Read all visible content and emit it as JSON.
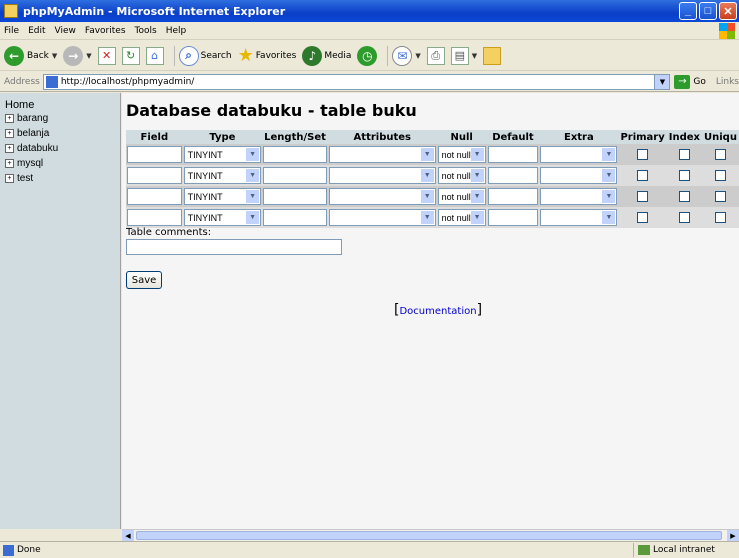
{
  "window": {
    "title": "phpMyAdmin - Microsoft Internet Explorer"
  },
  "menu": [
    "File",
    "Edit",
    "View",
    "Favorites",
    "Tools",
    "Help"
  ],
  "toolbar": {
    "back": "Back",
    "search": "Search",
    "favorites": "Favorites",
    "media": "Media"
  },
  "address": {
    "label": "Address",
    "url": "http://localhost/phpmyadmin/",
    "go": "Go",
    "links": "Links"
  },
  "sidebar": {
    "home": "Home",
    "databases": [
      "barang",
      "belanja",
      "databuku",
      "mysql",
      "test"
    ]
  },
  "main": {
    "title": "Database databuku - table buku",
    "columns": [
      "Field",
      "Type",
      "Length/Set",
      "Attributes",
      "Null",
      "Default",
      "Extra",
      "Primary",
      "Index",
      "Uniqu"
    ],
    "rows": [
      {
        "field": "",
        "type": "TINYINT",
        "length": "",
        "attributes": "",
        "null": "not null",
        "default": "",
        "extra": ""
      },
      {
        "field": "",
        "type": "TINYINT",
        "length": "",
        "attributes": "",
        "null": "not null",
        "default": "",
        "extra": ""
      },
      {
        "field": "",
        "type": "TINYINT",
        "length": "",
        "attributes": "",
        "null": "not null",
        "default": "",
        "extra": ""
      },
      {
        "field": "",
        "type": "TINYINT",
        "length": "",
        "attributes": "",
        "null": "not null",
        "default": "",
        "extra": ""
      }
    ],
    "table_comments_label": "Table comments:",
    "table_comments_value": "",
    "save_label": "Save",
    "documentation_label": "Documentation"
  },
  "status": {
    "text": "Done",
    "zone": "Local intranet"
  }
}
